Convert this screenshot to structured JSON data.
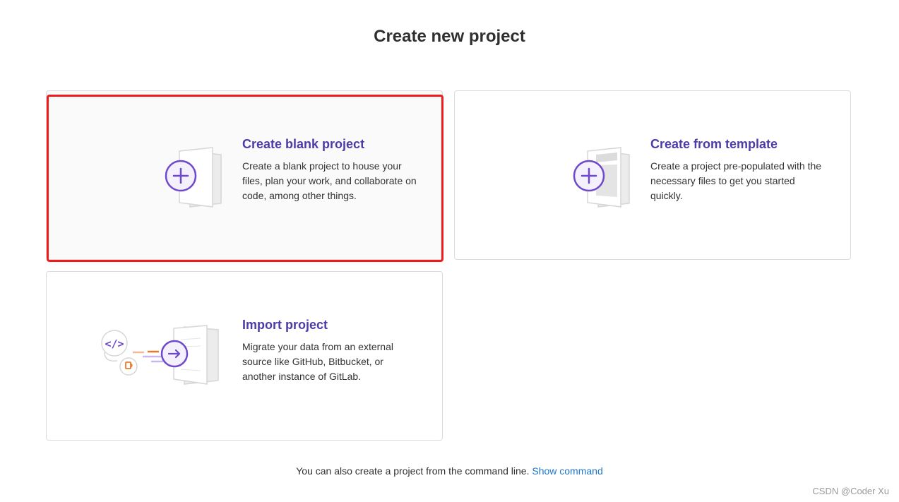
{
  "page": {
    "title": "Create new project"
  },
  "cards": {
    "blank": {
      "title": "Create blank project",
      "description": "Create a blank project to house your files, plan your work, and collaborate on code, among other things."
    },
    "template": {
      "title": "Create from template",
      "description": "Create a project pre-populated with the necessary files to get you started quickly."
    },
    "import": {
      "title": "Import project",
      "description": "Migrate your data from an external source like GitHub, Bitbucket, or another instance of GitLab."
    }
  },
  "footer": {
    "text": "You can also create a project from the command line.",
    "link": "Show command"
  },
  "watermark": "CSDN @Coder Xu",
  "icons": {
    "blank": "plus-document-icon",
    "template": "template-document-icon",
    "import": "import-arrow-icon"
  },
  "colors": {
    "accent": "#6e49cb",
    "title": "#4b3ca7",
    "link": "#1f75cb",
    "highlight": "#ee1c1c",
    "orange": "#e9782a"
  }
}
